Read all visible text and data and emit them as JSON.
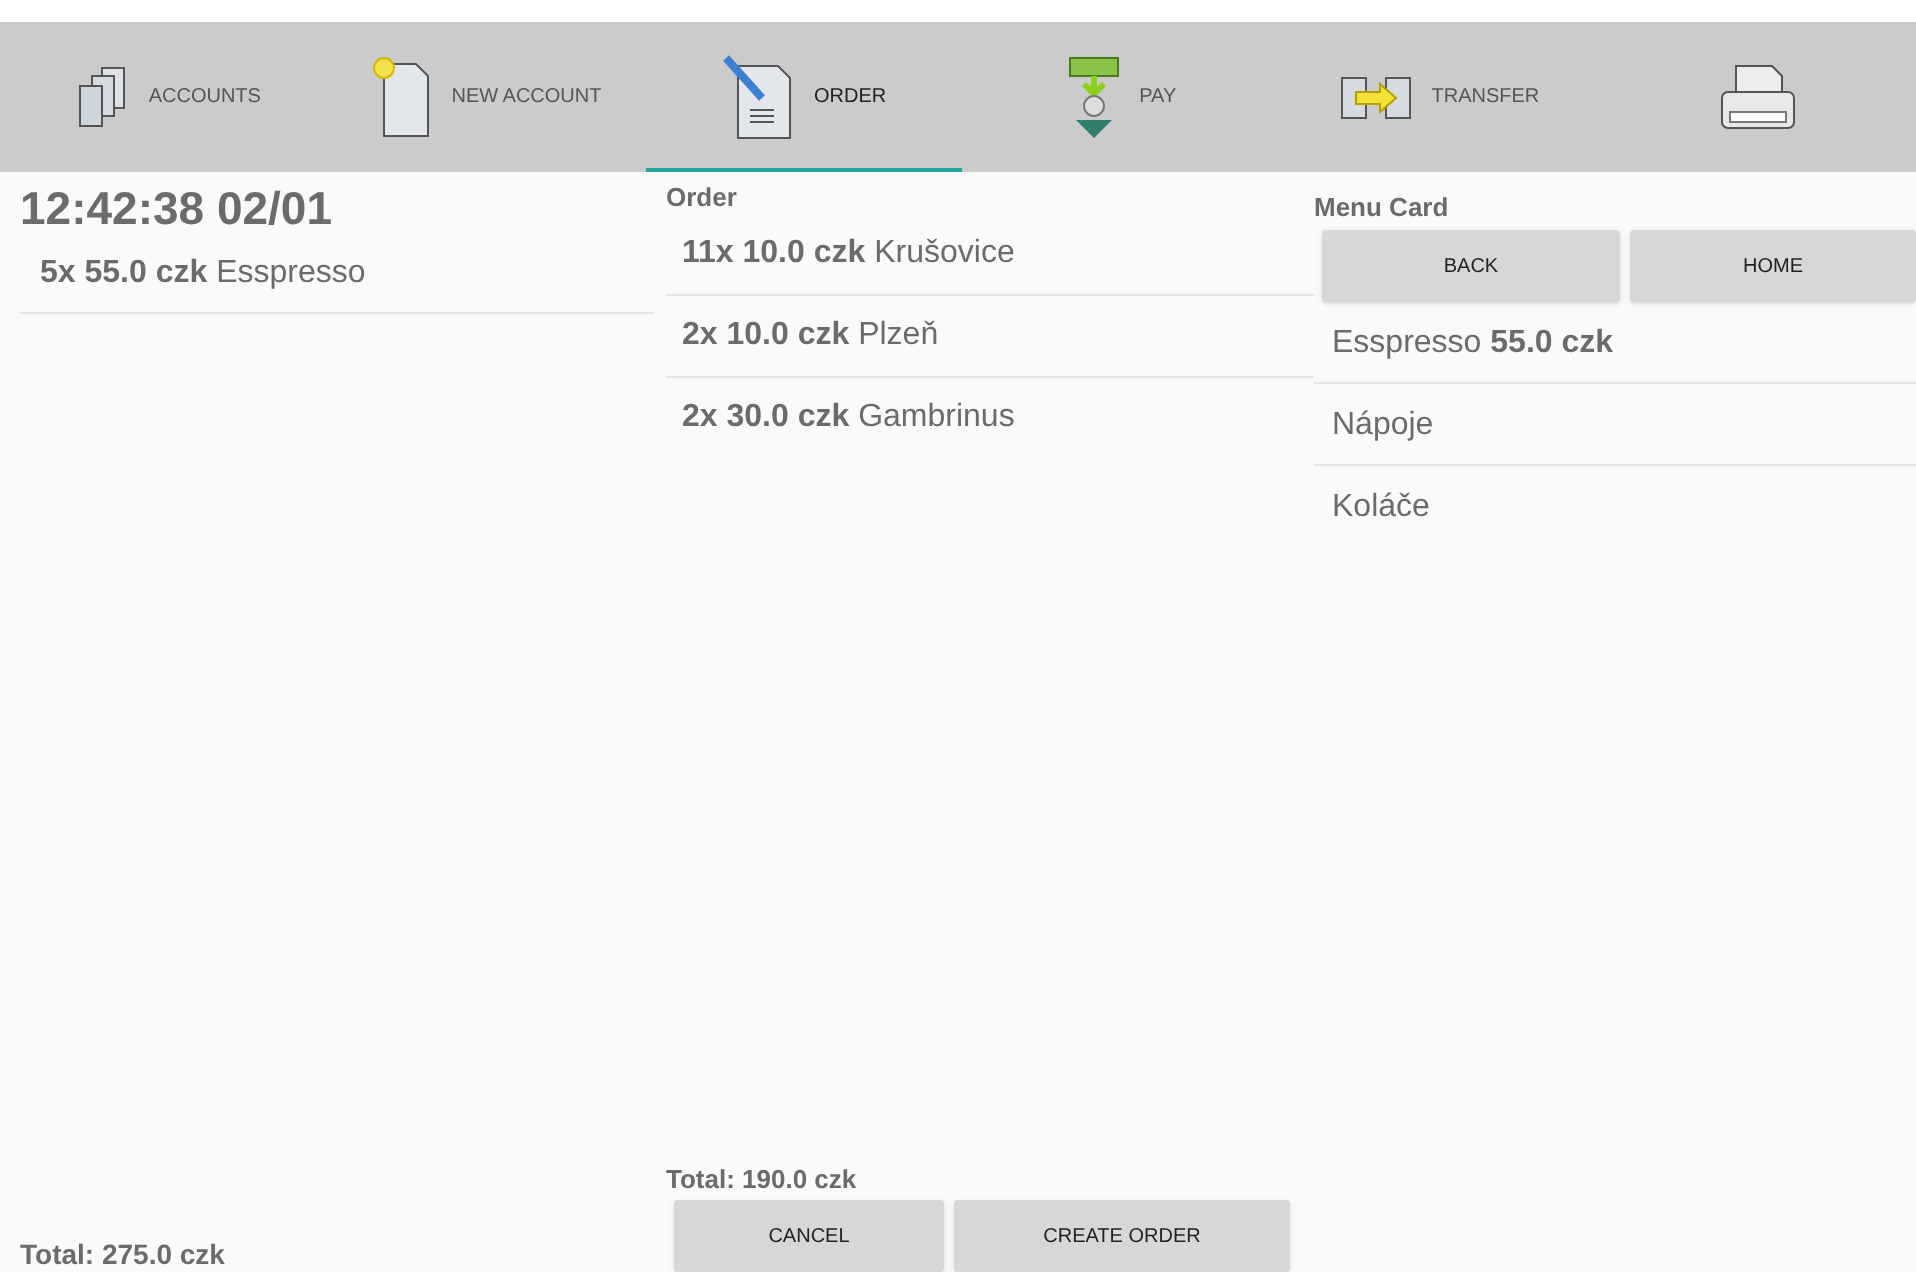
{
  "tabs": [
    {
      "label": "ACCOUNTS",
      "selected": false
    },
    {
      "label": "NEW ACCOUNT",
      "selected": false
    },
    {
      "label": "ORDER",
      "selected": true
    },
    {
      "label": "PAY",
      "selected": false
    },
    {
      "label": "TRANSFER",
      "selected": false
    },
    {
      "selected": false
    }
  ],
  "account": {
    "title": "12:42:38 02/01",
    "items": [
      "**5x 55.0 czk** Esspresso"
    ],
    "total": "Total: 275.0 czk"
  },
  "order": {
    "heading": "Order",
    "items": [
      "**11x 10.0 czk** Krušovice",
      "**2x 10.0 czk** Plzeň",
      "**2x 30.0 czk** Gambrinus"
    ],
    "total": "Total: 190.0 czk",
    "buttons": [
      "CANCEL",
      "CREATE ORDER"
    ]
  },
  "menu_card": {
    "heading": "Menu Card",
    "buttons": [
      "BACK",
      "HOME"
    ],
    "items": [
      "Esspresso **55.0 czk**",
      "Nápoje",
      "Koláče"
    ]
  }
}
